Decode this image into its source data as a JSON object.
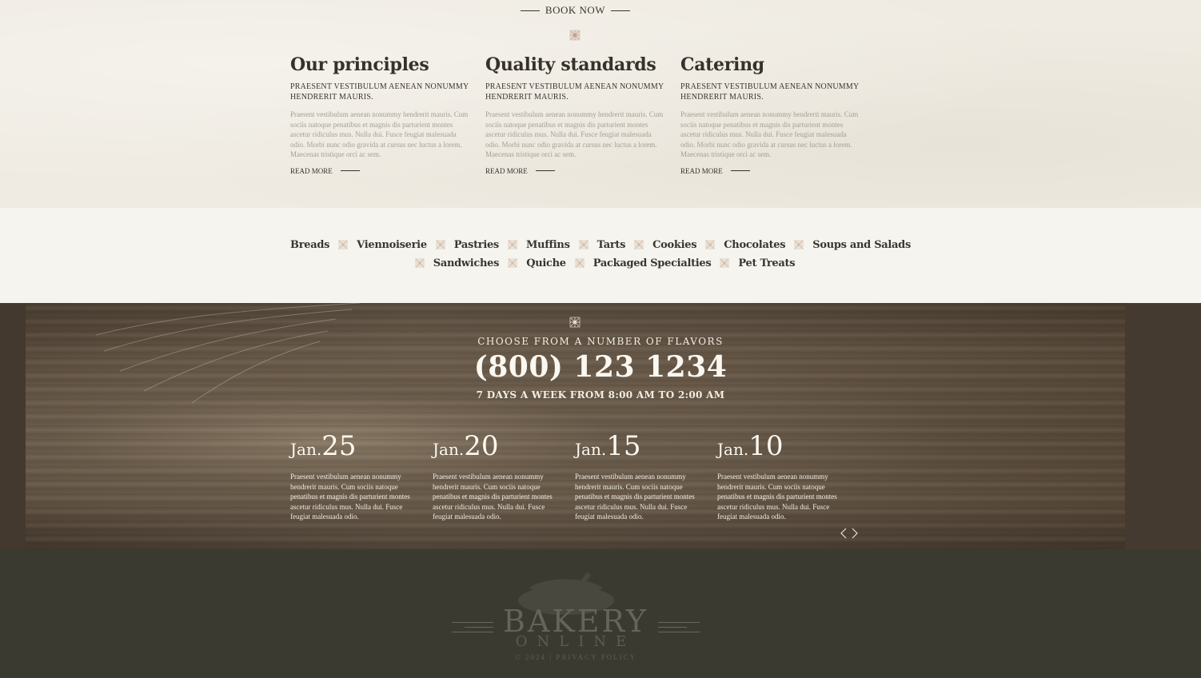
{
  "book_now": "BOOK NOW",
  "columns": [
    {
      "title": "Our principles",
      "subtitle": "PRAESENT VESTIBULUM AENEAN NONUMMY HENDRERIT MAURIS.",
      "body": "Praesent vestibulum aenean nonummy hendrerit mauris. Cum sociis natoque penatibus et magnis dis parturient montes ascetur ridiculus mus. Nulla dui. Fusce feugiat malesuada odio. Morbi nunc odio gravida at cursus nec luctus a lorem. Maecenas tristique orci ac sem.",
      "read_more": "READ MORE"
    },
    {
      "title": "Quality standards",
      "subtitle": "PRAESENT VESTIBULUM AENEAN NONUMMY HENDRERIT MAURIS.",
      "body": "Praesent vestibulum aenean nonummy hendrerit mauris. Cum sociis natoque penatibus et magnis dis parturient montes ascetur ridiculus mus. Nulla dui. Fusce feugiat malesuada odio. Morbi nunc odio gravida at cursus nec luctus a lorem. Maecenas tristique orci ac sem.",
      "read_more": "READ MORE"
    },
    {
      "title": "Catering",
      "subtitle": "PRAESENT VESTIBULUM AENEAN NONUMMY HENDRERIT MAURIS.",
      "body": "Praesent vestibulum aenean nonummy hendrerit mauris. Cum sociis natoque penatibus et magnis dis parturient montes ascetur ridiculus mus. Nulla dui. Fusce feugiat malesuada odio. Morbi nunc odio gravida at cursus nec luctus a lorem. Maecenas tristique orci ac sem.",
      "read_more": "READ MORE"
    }
  ],
  "categories": {
    "row1": [
      "Breads",
      "Viennoiserie",
      "Pastries",
      "Muffins",
      "Tarts",
      "Cookies",
      "Chocolates",
      "Soups and Salads"
    ],
    "row2": [
      "Sandwiches",
      "Quiche",
      "Packaged Specialties",
      "Pet Treats"
    ]
  },
  "contact": {
    "tagline": "CHOOSE FROM A NUMBER OF FLAVORS",
    "phone": "(800) 123 1234",
    "hours": "7 DAYS A WEEK FROM 8:00 AM TO 2:00 AM"
  },
  "news": [
    {
      "month": "Jan.",
      "day": "25",
      "text": "Praesent vestibulum aenean nonummy hendrerit mauris. Cum sociis natoque penatibus et magnis dis parturient montes ascetur ridiculus mus. Nulla dui. Fusce feugiat malesuada odio."
    },
    {
      "month": "Jan.",
      "day": "20",
      "text": "Praesent vestibulum aenean nonummy hendrerit mauris. Cum sociis natoque penatibus et magnis dis parturient montes ascetur ridiculus mus. Nulla dui. Fusce feugiat malesuada odio."
    },
    {
      "month": "Jan.",
      "day": "15",
      "text": "Praesent vestibulum aenean nonummy hendrerit mauris. Cum sociis natoque penatibus et magnis dis parturient montes ascetur ridiculus mus. Nulla dui. Fusce feugiat malesuada odio."
    },
    {
      "month": "Jan.",
      "day": "10",
      "text": "Praesent vestibulum aenean nonummy hendrerit mauris. Cum sociis natoque penatibus et magnis dis parturient montes ascetur ridiculus mus. Nulla dui. Fusce feugiat malesuada odio."
    }
  ],
  "carousel": {
    "prev_icon": "chevron-left-icon",
    "next_icon": "chevron-right-icon"
  },
  "footer": {
    "logo_title": "BAKERY",
    "logo_sub": "ONLINE",
    "copyright": "© 2024 | PRIVACY POLICY"
  },
  "colors": {
    "parchment": "#efebe2",
    "band": "#f6f4ef",
    "wood": "#5f5040",
    "footer": "#3a3a31",
    "heading": "#35322b",
    "muted_text": "#a49f93"
  }
}
